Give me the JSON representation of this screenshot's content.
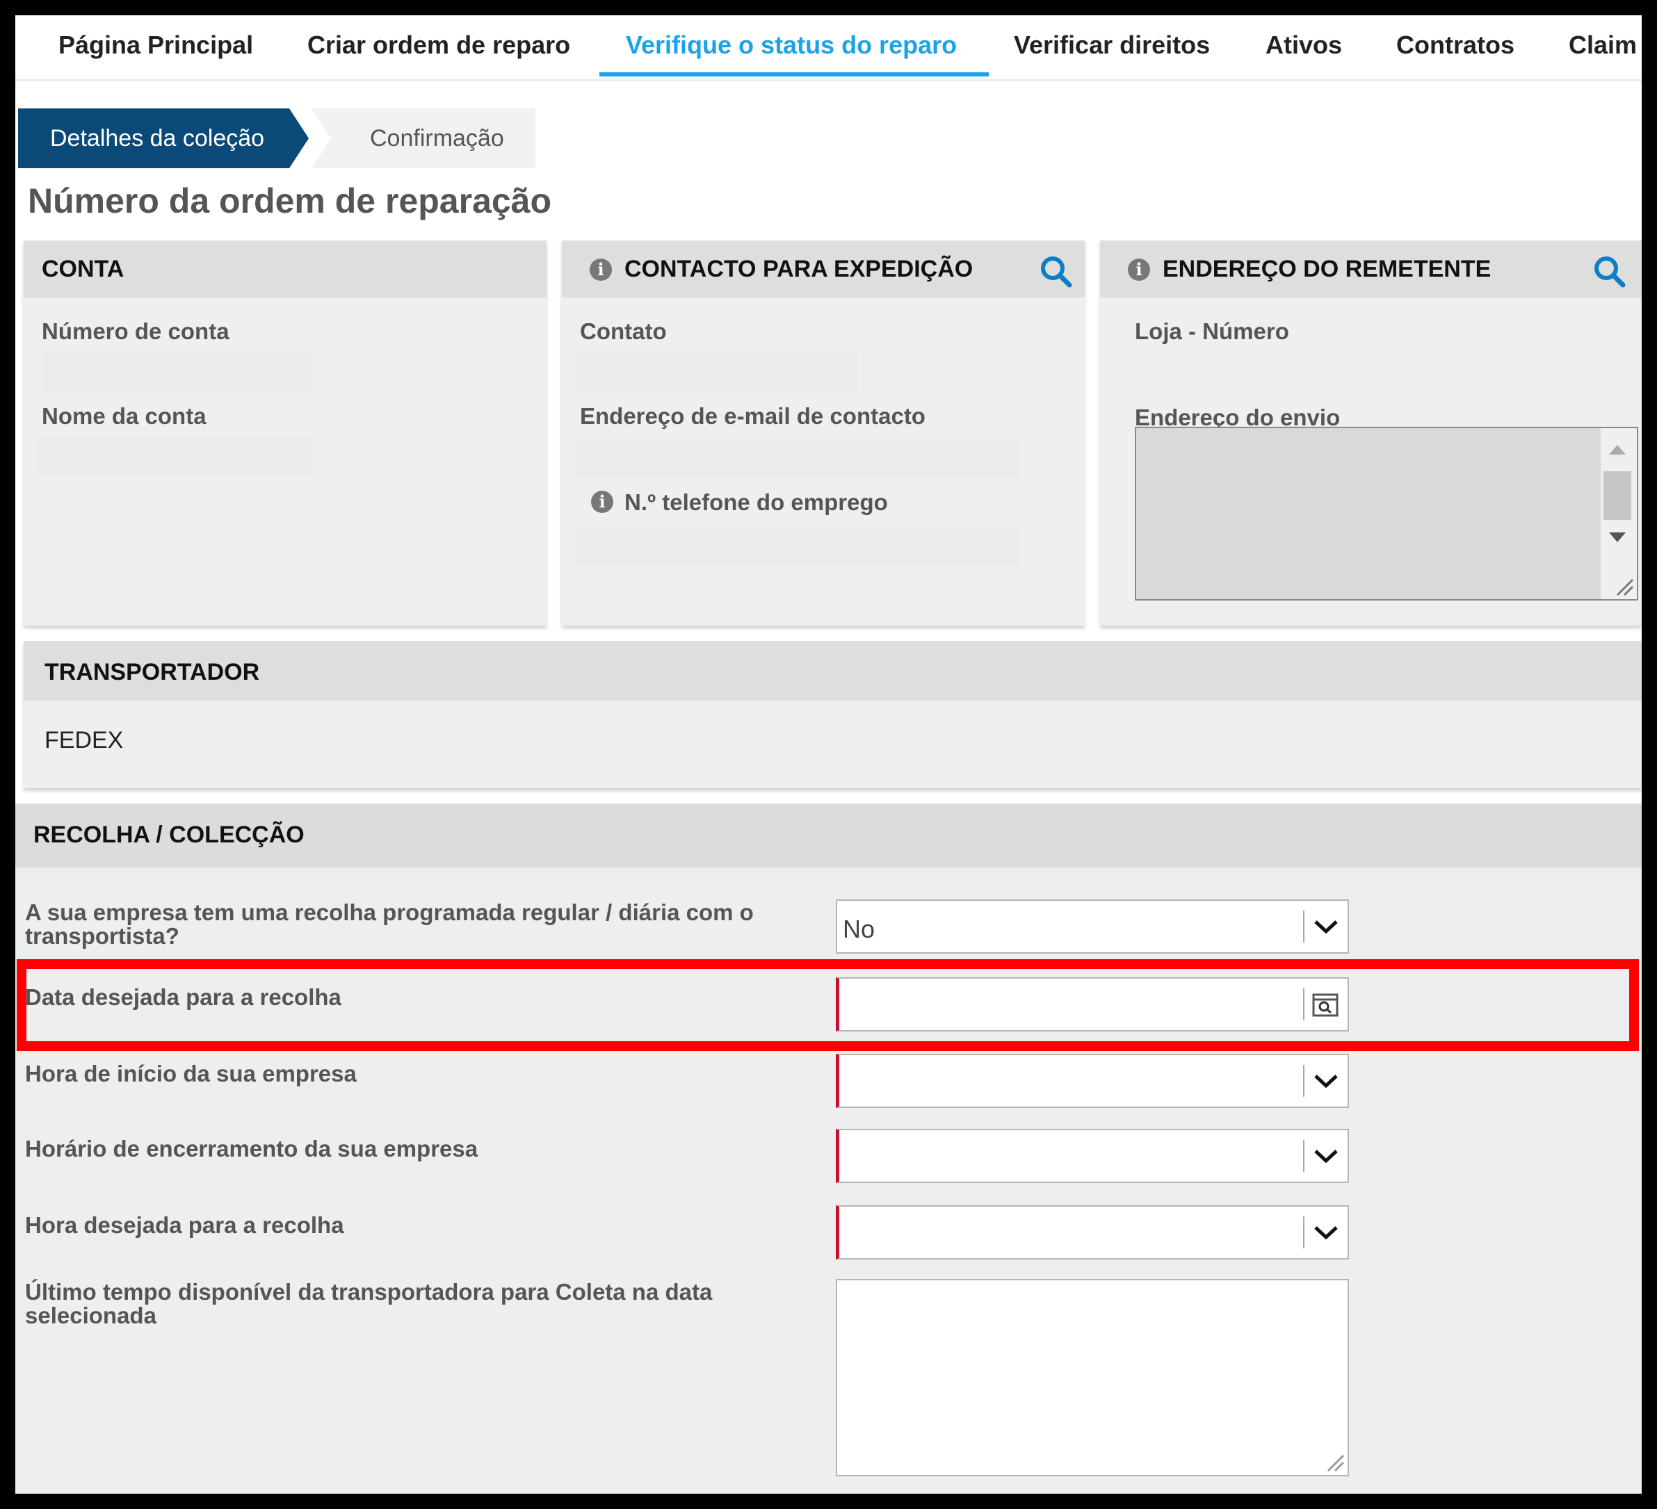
{
  "nav": {
    "items": [
      {
        "label": "Página Principal"
      },
      {
        "label": "Criar ordem de reparo"
      },
      {
        "label": "Verifique o status do reparo"
      },
      {
        "label": "Verificar direitos"
      },
      {
        "label": "Ativos"
      },
      {
        "label": "Contratos"
      },
      {
        "label": "Claim"
      }
    ],
    "active_color": "#1aa3e8"
  },
  "wizard": {
    "step1": "Detalhes da coleção",
    "step2": "Confirmação"
  },
  "page_title": "Número da ordem de reparação",
  "panels": {
    "account": {
      "title": "CONTA",
      "fields": [
        "Número de conta",
        "Nome da conta"
      ]
    },
    "shipping_contact": {
      "title": "CONTACTO PARA EXPEDIÇÃO",
      "fields": [
        "Contato",
        "Endereço de e-mail de contacto",
        "N.º telefone do emprego"
      ]
    },
    "sender_address": {
      "title": "ENDEREÇO DO REMETENTE",
      "fields": [
        "Loja - Número",
        "Endereço do envio"
      ]
    },
    "carrier": {
      "title": "TRANSPORTADOR",
      "value": "FEDEX"
    }
  },
  "collection": {
    "title": "RECOLHA / COLECÇÃO",
    "rows": {
      "scheduled": {
        "label": "A sua empresa tem uma recolha programada regular / diária com o transportista?",
        "value": "No"
      },
      "date": {
        "label": "Data desejada para a recolha",
        "value": ""
      },
      "start": {
        "label": "Hora de início da sua empresa",
        "value": ""
      },
      "close": {
        "label": "Horário de encerramento da sua empresa",
        "value": ""
      },
      "time": {
        "label": "Hora desejada para a recolha",
        "value": ""
      },
      "latest": {
        "label": "Último tempo disponível da transportadora para Coleta na data selecionada",
        "value": ""
      }
    }
  },
  "colors": {
    "step_active": "#0b4a78",
    "required_marker": "#c8102e",
    "highlight": "#ff0000",
    "icon_blue": "#0a7fc6"
  }
}
